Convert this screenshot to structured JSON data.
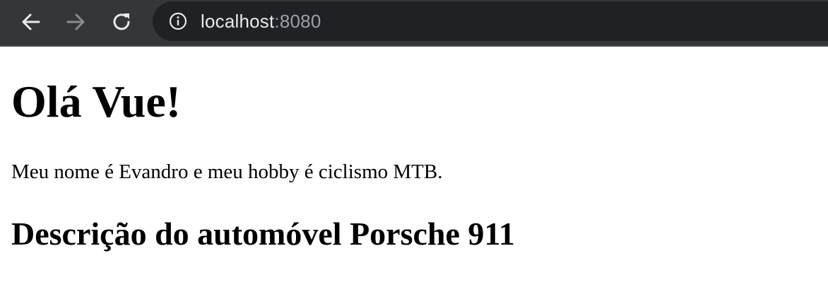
{
  "browser": {
    "nav": {
      "back_icon": "arrow-left-icon",
      "forward_icon": "arrow-right-icon",
      "reload_icon": "reload-icon"
    },
    "address": {
      "info_icon": "info-circle-icon",
      "host": "localhost",
      "port": ":8080"
    },
    "colors": {
      "toolbar_bg": "#35363a",
      "omnibox_bg": "#202124",
      "host_text": "#e8eaed",
      "port_text": "#9aa0a6",
      "icon_enabled": "#e8eaed",
      "icon_disabled": "#8a8c90"
    }
  },
  "page": {
    "heading": "Olá Vue!",
    "paragraph": "Meu nome é Evandro e meu hobby é ciclismo MTB.",
    "subheading": "Descrição do automóvel Porsche 911"
  }
}
